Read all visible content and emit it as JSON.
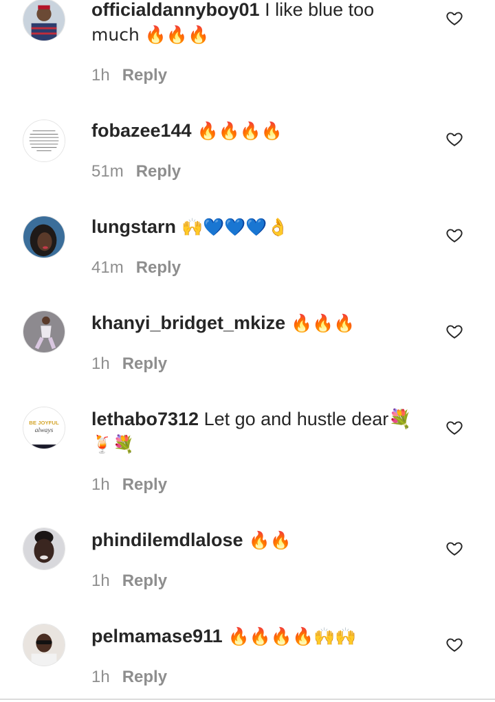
{
  "comments": [
    {
      "username": "officialdannyboy01",
      "text": " I like blue too",
      "text2": "much 🔥🔥🔥",
      "time": "1h",
      "reply": "Reply",
      "avatar": "man-in-plaid-shirt-photo"
    },
    {
      "username": "fobazee144",
      "text": " 🔥🔥🔥🔥",
      "time": "51m",
      "reply": "Reply",
      "avatar": "prayer-text-image"
    },
    {
      "username": "lungstarn",
      "text": " 🙌💙💙💙👌",
      "time": "41m",
      "reply": "Reply",
      "avatar": "woman-portrait-photo"
    },
    {
      "username": "khanyi_bridget_mkize",
      "text": " 🔥🔥🔥",
      "time": "1h",
      "reply": "Reply",
      "avatar": "person-full-body-photo"
    },
    {
      "username": "lethabo7312",
      "text": " Let go and hustle dear💐",
      "text2": "🍹💐",
      "time": "1h",
      "reply": "Reply",
      "avatar": "be-joyful-always-logo"
    },
    {
      "username": "phindilemdlalose",
      "text": " 🔥🔥",
      "time": "1h",
      "reply": "Reply",
      "avatar": "woman-smiling-photo"
    },
    {
      "username": "pelmamase911",
      "text": " 🔥🔥🔥🔥🙌🙌",
      "time": "1h",
      "reply": "Reply",
      "avatar": "woman-sunglasses-photo"
    }
  ],
  "avatar_logo_text": {
    "line1": "BE JOYFUL",
    "line2": "always"
  },
  "colors": {
    "text": "#262626",
    "meta": "#8e8e8e",
    "divider": "#dbdbdb"
  },
  "icons": {
    "like": "heart-outline-icon"
  }
}
